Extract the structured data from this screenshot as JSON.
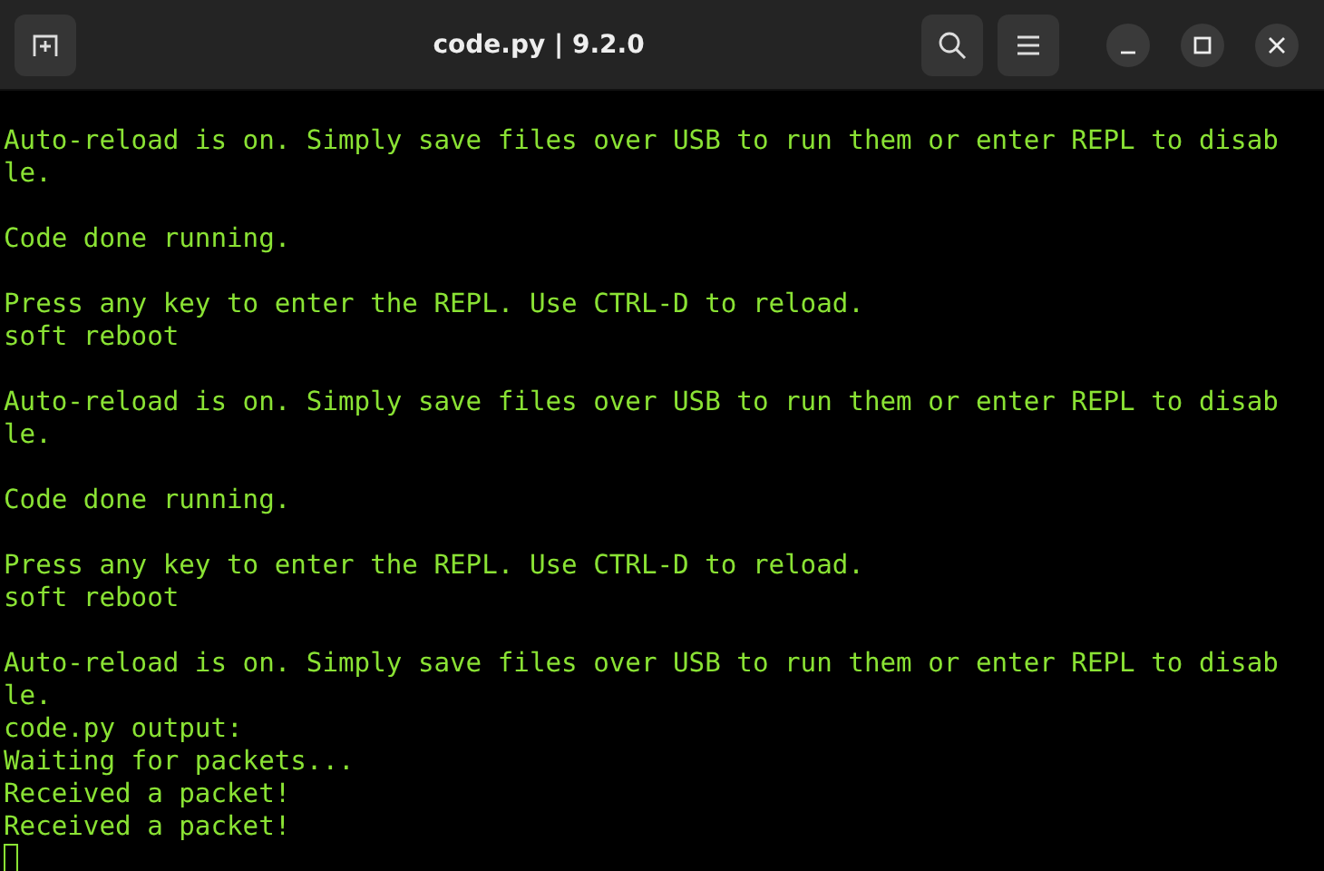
{
  "window": {
    "title": "code.py | 9.2.0"
  },
  "terminal": {
    "lines": [
      {
        "kind": "text",
        "text": "Auto-reload is on. Simply save files over USB to run them or enter REPL to disab"
      },
      {
        "kind": "text",
        "text": "le."
      },
      {
        "kind": "blank"
      },
      {
        "kind": "text",
        "text": "Code done running."
      },
      {
        "kind": "blank"
      },
      {
        "kind": "text",
        "text": "Press any key to enter the REPL. Use CTRL-D to reload."
      },
      {
        "kind": "text",
        "text": "soft reboot"
      },
      {
        "kind": "blank"
      },
      {
        "kind": "text",
        "text": "Auto-reload is on. Simply save files over USB to run them or enter REPL to disab"
      },
      {
        "kind": "text",
        "text": "le."
      },
      {
        "kind": "blank"
      },
      {
        "kind": "text",
        "text": "Code done running."
      },
      {
        "kind": "blank"
      },
      {
        "kind": "text",
        "text": "Press any key to enter the REPL. Use CTRL-D to reload."
      },
      {
        "kind": "text",
        "text": "soft reboot"
      },
      {
        "kind": "blank"
      },
      {
        "kind": "text",
        "text": "Auto-reload is on. Simply save files over USB to run them or enter REPL to disab"
      },
      {
        "kind": "text",
        "text": "le."
      },
      {
        "kind": "text",
        "text": "code.py output:"
      },
      {
        "kind": "text",
        "text": "Waiting for packets..."
      },
      {
        "kind": "text",
        "text": "Received a packet!"
      },
      {
        "kind": "text",
        "text": "Received a packet!"
      },
      {
        "kind": "cursor"
      }
    ]
  }
}
